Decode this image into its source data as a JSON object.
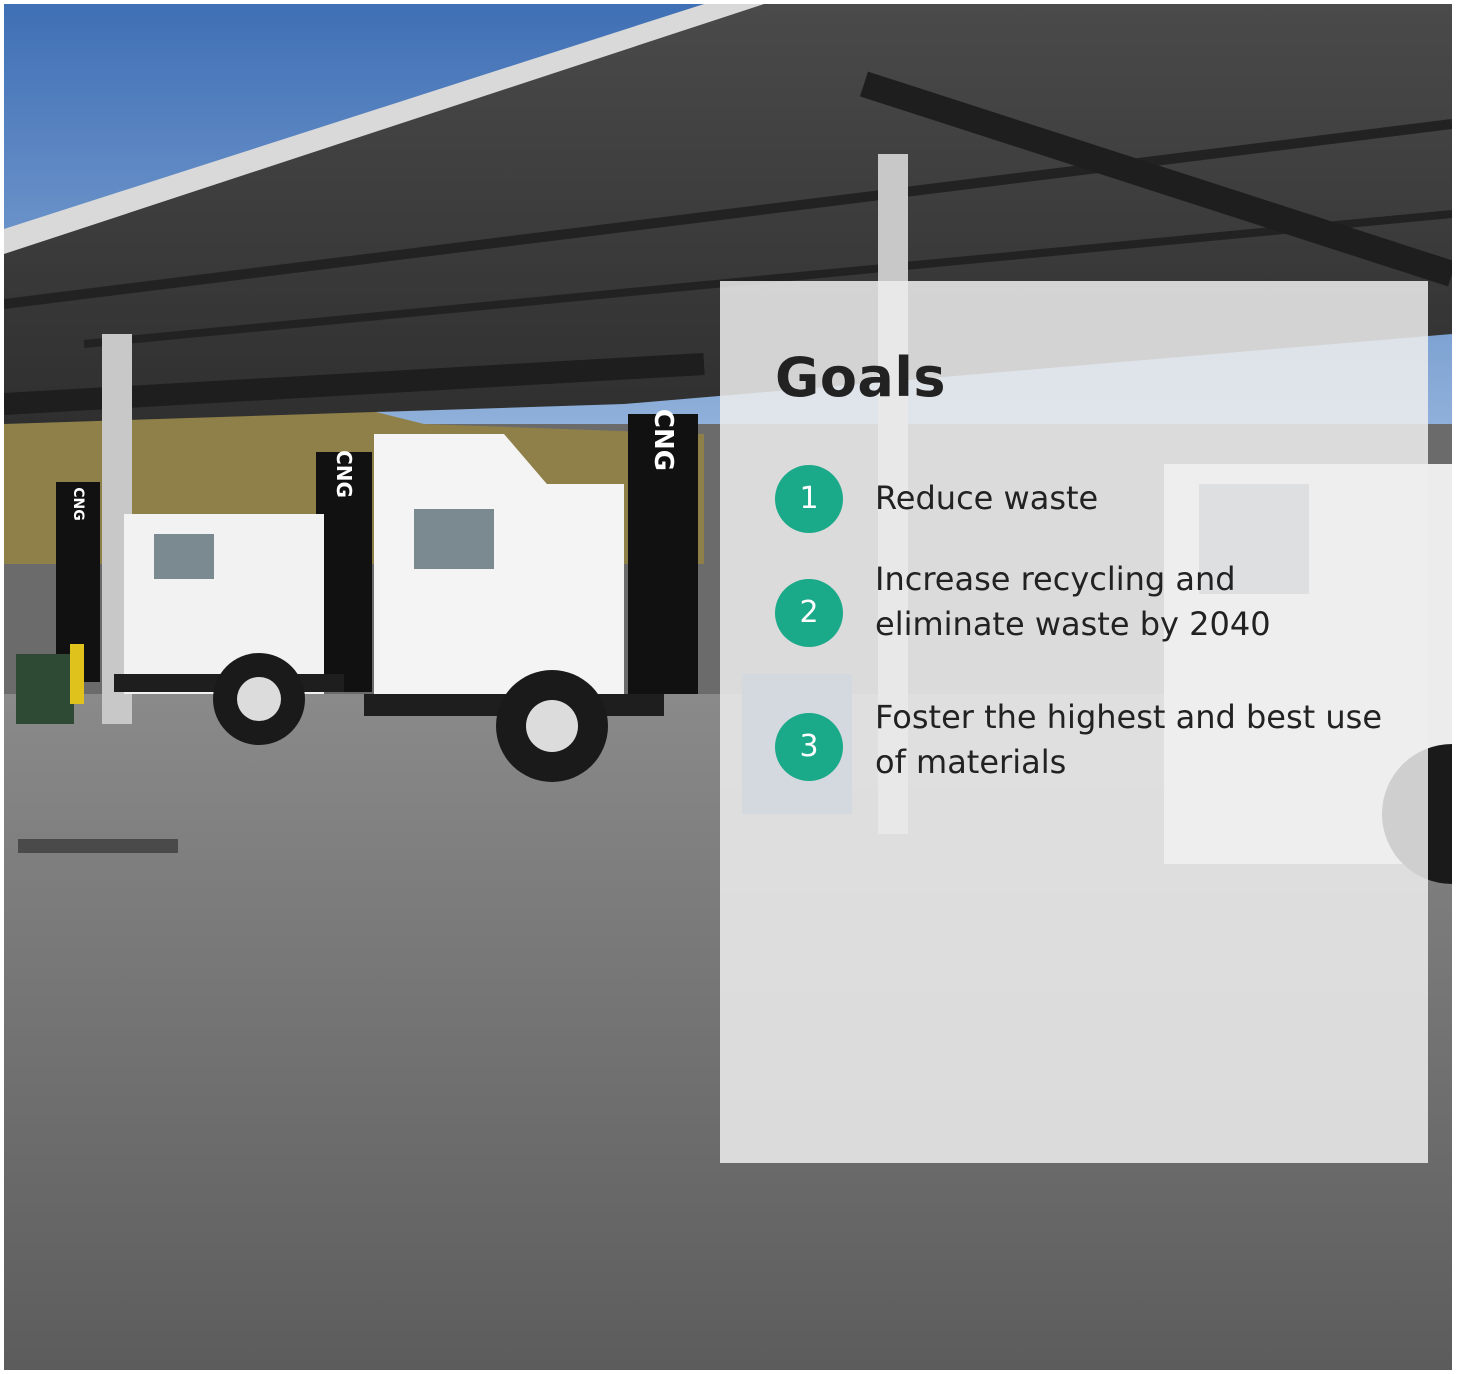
{
  "photo": {
    "alt": "White CNG garbage trucks parked under a fueling canopy",
    "truck_label": "CNG"
  },
  "goals": {
    "title": "Goals",
    "items": [
      {
        "number": "1",
        "text": "Reduce waste"
      },
      {
        "number": "2",
        "text": "Increase recycling and eliminate waste by 2040"
      },
      {
        "number": "3",
        "text": "Foster the highest and best use of materials"
      }
    ]
  },
  "colors": {
    "accent": "#1aa989",
    "panel": "#eeeeee",
    "text": "#222222"
  }
}
